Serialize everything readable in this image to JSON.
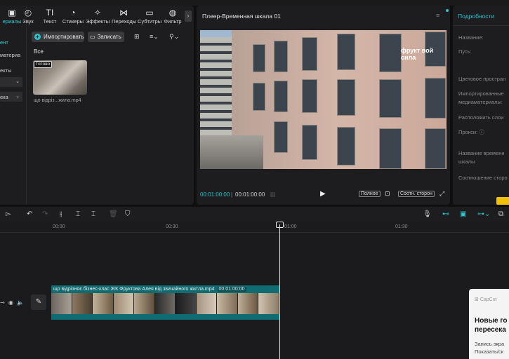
{
  "toolbar": {
    "items": [
      {
        "label": "ериалы",
        "icon": "media-icon"
      },
      {
        "label": "Звук",
        "icon": "audio-icon"
      },
      {
        "label": "Текст",
        "icon": "text-icon"
      },
      {
        "label": "Стикеры",
        "icon": "sticker-icon"
      },
      {
        "label": "Эффекты",
        "icon": "effects-icon"
      },
      {
        "label": "Переходы",
        "icon": "transitions-icon"
      },
      {
        "label": "Субтитры",
        "icon": "subtitles-icon"
      },
      {
        "label": "Фильтр",
        "icon": "filters-icon"
      }
    ]
  },
  "left_categories": {
    "item1": "ент",
    "item2": "материа",
    "item3": "екты",
    "item4": "ека"
  },
  "media": {
    "import_label": "Импортировать",
    "record_label": "Записать",
    "filter_all": "Все",
    "clip_badge": "Готово",
    "clip_name": "що відріз...жила.mp4"
  },
  "player": {
    "title": "Плеер-Временная шкала 01",
    "current_time": "00:01:00:00",
    "total_time": "00:01:00:00",
    "fullscreen_label": "Полное",
    "ratio_label": "Соотн. сторон",
    "logo_text": "фрукт вой сила"
  },
  "details": {
    "title": "Подробности",
    "labels": [
      "Название:",
      "Путь:",
      "Цветовое простран",
      "Импортированные медиаматериалы:",
      "Расположить слои",
      "Прокси:",
      "Название временн шкалы",
      "Соотношение сторо"
    ]
  },
  "timeline": {
    "ruler": [
      "00:00",
      "00:30",
      "01:00",
      "01:30"
    ],
    "clip_title": "що відрізняє бізнес-клас ЖК Фруктова Алея від звичайного житла.mp4",
    "clip_duration": "00:01:00:00"
  },
  "popup": {
    "brand": "CapCut",
    "heading": "Новые го пересека",
    "body": "Запись экра Показать/ск"
  },
  "colors": {
    "accent": "#27c4cf",
    "clip": "#0f6c73",
    "panel": "#1d1d1f"
  }
}
